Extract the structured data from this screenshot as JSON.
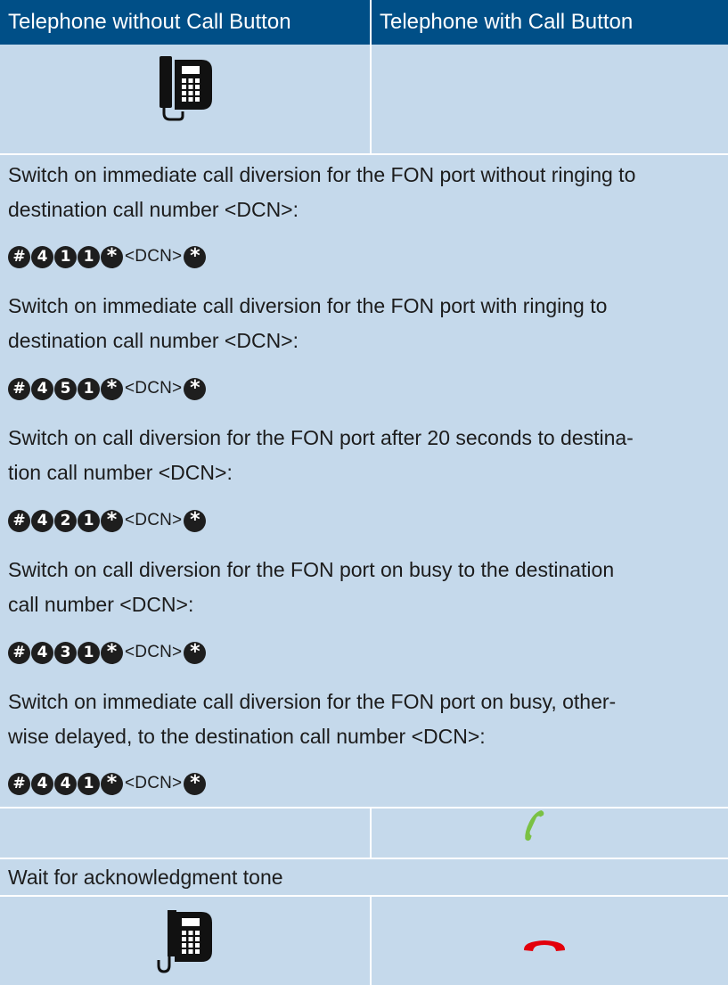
{
  "header": {
    "col_without": "Telephone without Call Button",
    "col_with": "Telephone with Call Button"
  },
  "icons": {
    "desk_phone_lift": "desk-phone-handset-off-icon",
    "handset_green": "green-handset-lift-icon",
    "desk_phone_hangup": "desk-phone-handset-on-icon",
    "handset_red": "red-handset-hangup-icon",
    "colors": {
      "header": "#004f87",
      "cell": "#c5d9eb",
      "green": "#7ac143",
      "red": "#e3000b"
    }
  },
  "instructions": [
    {
      "text": "Switch on immediate call diversion for the FON port without ringing to destination call number <DCN>:",
      "keys": [
        "#",
        "4",
        "1",
        "1",
        "*"
      ],
      "placeholder": "<DCN>",
      "end_key": "*"
    },
    {
      "text": "Switch on immediate call diversion for the FON port with ringing to destination call number <DCN>:",
      "keys": [
        "#",
        "4",
        "5",
        "1",
        "*"
      ],
      "placeholder": "<DCN>",
      "end_key": "*"
    },
    {
      "text": "Switch on call diversion for the FON port after 20 seconds to destina-tion call number <DCN>:",
      "keys": [
        "#",
        "4",
        "2",
        "1",
        "*"
      ],
      "placeholder": "<DCN>",
      "end_key": "*"
    },
    {
      "text": "Switch on call diversion for the FON port on busy to the destination call number <DCN>:",
      "keys": [
        "#",
        "4",
        "3",
        "1",
        "*"
      ],
      "placeholder": "<DCN>",
      "end_key": "*"
    },
    {
      "text": "Switch on immediate call diversion for the FON port on busy, other-wise delayed, to the destination call number <DCN>:",
      "keys": [
        "#",
        "4",
        "4",
        "1",
        "*"
      ],
      "placeholder": "<DCN>",
      "end_key": "*"
    }
  ],
  "wait_text": "Wait for acknowledgment tone"
}
